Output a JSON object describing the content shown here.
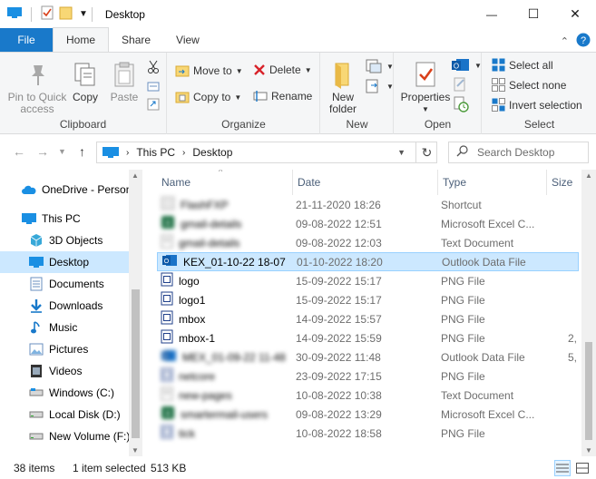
{
  "window": {
    "title": "Desktop",
    "minimize_glyph": "—",
    "maximize_glyph": "☐",
    "close_glyph": "✕"
  },
  "ribbon_tabs": [
    {
      "label": "File"
    },
    {
      "label": "Home"
    },
    {
      "label": "Share"
    },
    {
      "label": "View"
    }
  ],
  "ribbon": {
    "clipboard": {
      "group_label": "Clipboard",
      "pin_label": "Pin to Quick access",
      "copy_label": "Copy",
      "paste_label": "Paste"
    },
    "organize": {
      "group_label": "Organize",
      "move_to_label": "Move to",
      "copy_to_label": "Copy to",
      "delete_label": "Delete",
      "rename_label": "Rename"
    },
    "new": {
      "group_label": "New",
      "new_folder_label": "New folder"
    },
    "open": {
      "group_label": "Open",
      "properties_label": "Properties"
    },
    "select": {
      "group_label": "Select",
      "select_all_label": "Select all",
      "select_none_label": "Select none",
      "invert_label": "Invert selection"
    }
  },
  "address": {
    "crumbs": [
      "This PC",
      "Desktop"
    ],
    "search_placeholder": "Search Desktop"
  },
  "nav_pane": {
    "items": [
      {
        "label": "OneDrive - Person",
        "icon": "cloud-icon"
      },
      {
        "label": "This PC",
        "icon": "computer-icon"
      },
      {
        "label": "3D Objects",
        "icon": "cube-icon"
      },
      {
        "label": "Desktop",
        "icon": "desktop-icon",
        "selected": true
      },
      {
        "label": "Documents",
        "icon": "document-icon"
      },
      {
        "label": "Downloads",
        "icon": "download-icon"
      },
      {
        "label": "Music",
        "icon": "music-icon"
      },
      {
        "label": "Pictures",
        "icon": "picture-icon"
      },
      {
        "label": "Videos",
        "icon": "video-icon"
      },
      {
        "label": "Windows (C:)",
        "icon": "drive-icon"
      },
      {
        "label": "Local Disk (D:)",
        "icon": "drive-icon"
      },
      {
        "label": "New Volume (F:)",
        "icon": "drive-icon"
      }
    ]
  },
  "columns": {
    "name": "Name",
    "date": "Date",
    "type": "Type",
    "size": "Size"
  },
  "files": [
    {
      "name": "FlashFXP",
      "date": "21-11-2020 18:26",
      "type": "Shortcut",
      "size": "",
      "blurred": true,
      "icon": "shortcut-icon"
    },
    {
      "name": "gmail-details",
      "date": "09-08-2022 12:51",
      "type": "Microsoft Excel C...",
      "size": "",
      "blurred": true,
      "icon": "excel-icon"
    },
    {
      "name": "gmail-details",
      "date": "09-08-2022 12:03",
      "type": "Text Document",
      "size": "",
      "blurred": true,
      "icon": "text-icon"
    },
    {
      "name": "KEX_01-10-22 18-07",
      "date": "01-10-2022 18:20",
      "type": "Outlook Data File",
      "size": "",
      "blurred": false,
      "selected": true,
      "icon": "outlook-icon"
    },
    {
      "name": "logo",
      "date": "15-09-2022 15:17",
      "type": "PNG File",
      "size": "",
      "blurred": false,
      "icon": "png-icon"
    },
    {
      "name": "logo1",
      "date": "15-09-2022 15:17",
      "type": "PNG File",
      "size": "",
      "blurred": false,
      "icon": "png-icon"
    },
    {
      "name": "mbox",
      "date": "14-09-2022 15:57",
      "type": "PNG File",
      "size": "",
      "blurred": false,
      "icon": "png-icon"
    },
    {
      "name": "mbox-1",
      "date": "14-09-2022 15:59",
      "type": "PNG File",
      "size": "2,",
      "blurred": false,
      "icon": "png-icon"
    },
    {
      "name": "MEX_01-09-22 11-48",
      "date": "30-09-2022 11:48",
      "type": "Outlook Data File",
      "size": "5,",
      "blurred": true,
      "icon": "outlook-icon"
    },
    {
      "name": "netcore",
      "date": "23-09-2022 17:15",
      "type": "PNG File",
      "size": "",
      "blurred": true,
      "icon": "png-icon"
    },
    {
      "name": "new-pages",
      "date": "10-08-2022 10:38",
      "type": "Text Document",
      "size": "",
      "blurred": true,
      "icon": "text-icon"
    },
    {
      "name": "smartermail-users",
      "date": "09-08-2022 13:29",
      "type": "Microsoft Excel C...",
      "size": "",
      "blurred": true,
      "icon": "excel-icon"
    },
    {
      "name": "tick",
      "date": "10-08-2022 18:58",
      "type": "PNG File",
      "size": "",
      "blurred": true,
      "icon": "png-icon"
    }
  ],
  "status": {
    "item_count": "38 items",
    "selection": "1 item selected",
    "size": "513 KB"
  }
}
